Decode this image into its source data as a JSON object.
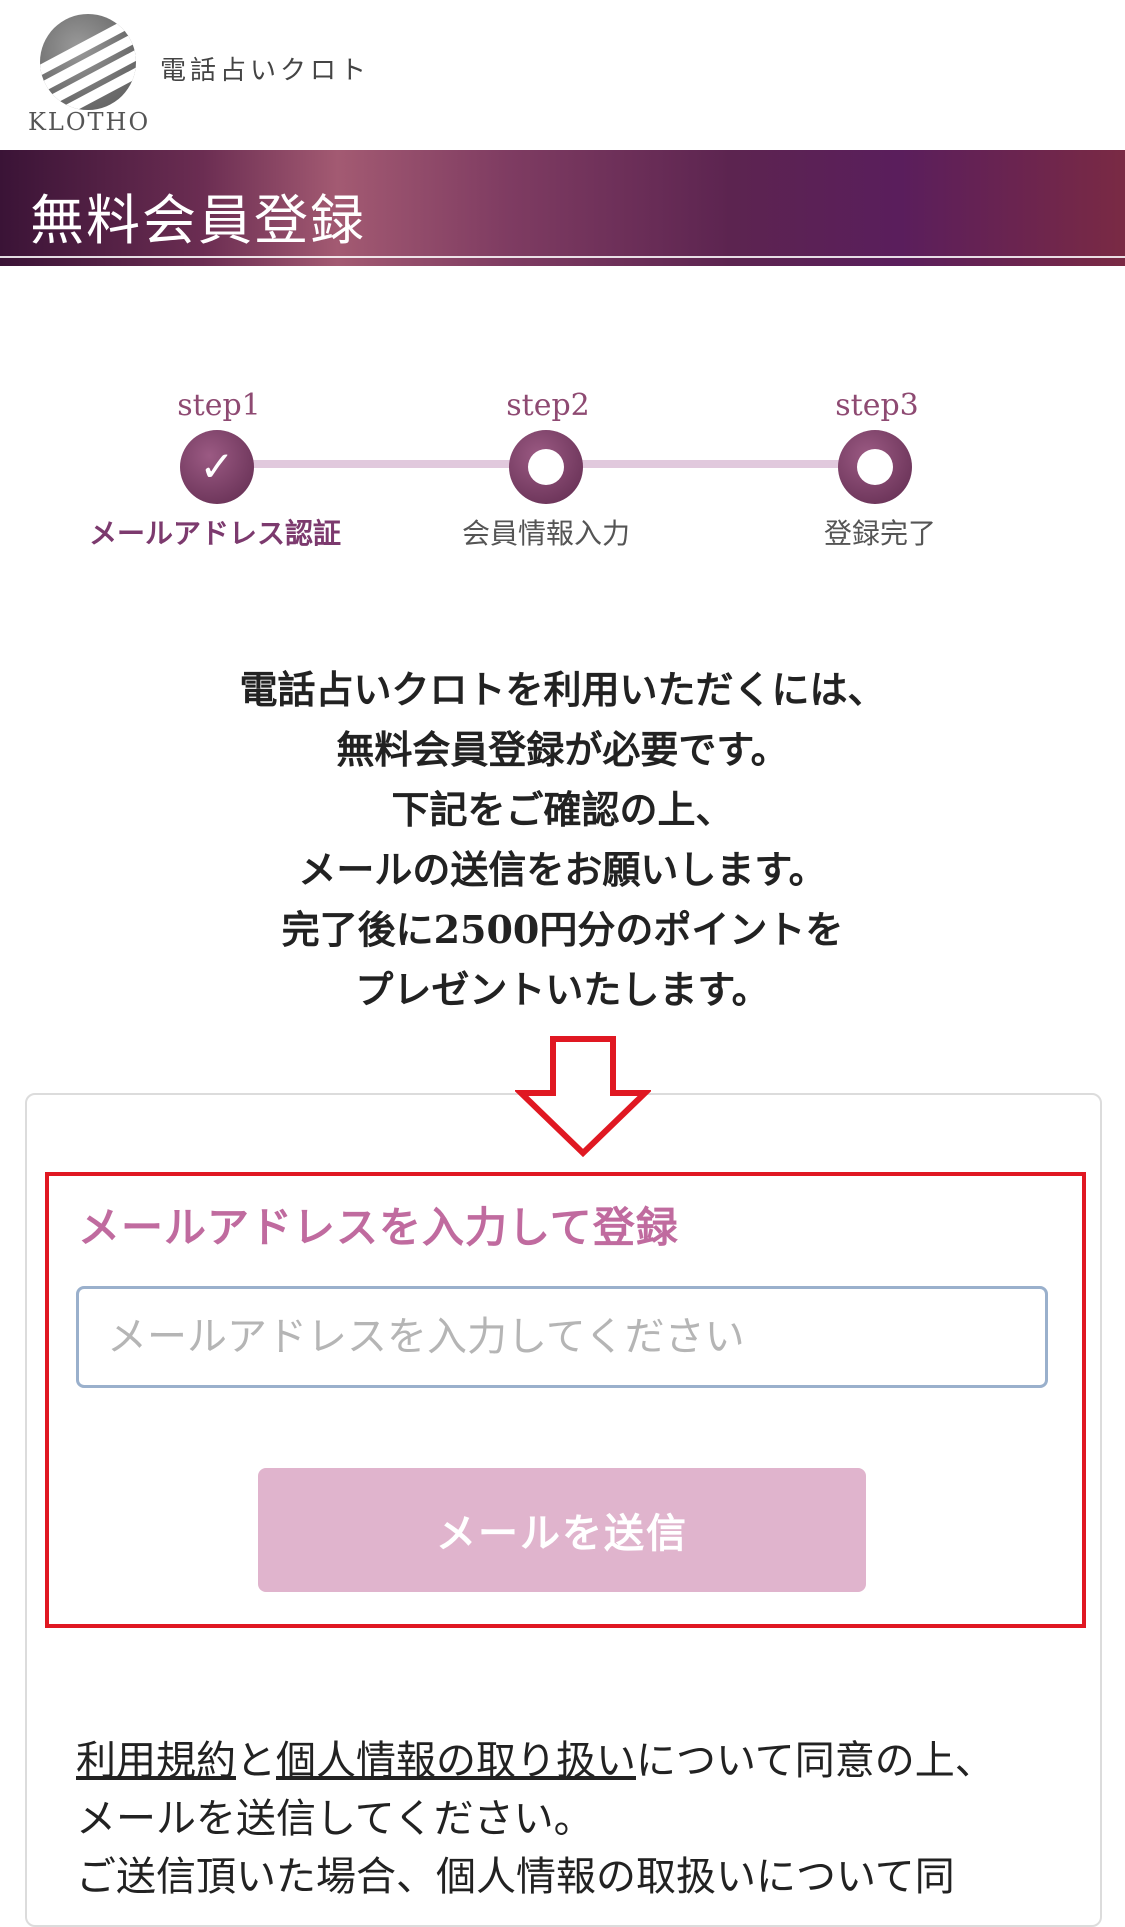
{
  "header": {
    "logo_word": "KLOTHO",
    "site_name": "電話占いクロト"
  },
  "title_band": {
    "title": "無料会員登録"
  },
  "steps": [
    {
      "label": "step1",
      "caption": "メールアドレス認証",
      "state": "done"
    },
    {
      "label": "step2",
      "caption": "会員情報入力",
      "state": "pending"
    },
    {
      "label": "step3",
      "caption": "登録完了",
      "state": "pending"
    }
  ],
  "intro": {
    "lines": [
      "電話占いクロトを利用いただくには、",
      "無料会員登録が必要です。",
      "下記をご確認の上、",
      "メールの送信をお願いします。",
      "完了後に2500円分のポイントを",
      "プレゼントいたします。"
    ]
  },
  "form": {
    "label": "メールアドレスを入力して登録",
    "email_placeholder": "メールアドレスを入力してください",
    "email_value": "",
    "submit_label": "メールを送信"
  },
  "terms": {
    "link_terms": "利用規約",
    "and": "と",
    "link_privacy": "個人情報の取り扱い",
    "rest_line1": "について同意の上、",
    "line2": "メールを送信してください。",
    "line3": "ご送信頂いた場合、個人情報の取扱いについて同"
  },
  "colors": {
    "accent": "#8e4a72",
    "highlight_border": "#e01822",
    "button_bg": "#e0b4cd"
  }
}
